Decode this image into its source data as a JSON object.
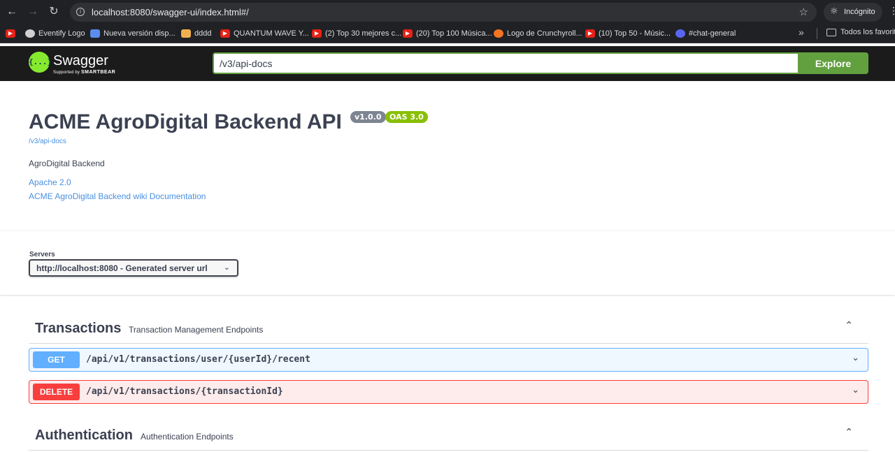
{
  "browser": {
    "url": "localhost:8080/swagger-ui/index.html#/",
    "incognito_label": "Incógnito",
    "bookmarks": [
      {
        "label": "",
        "icon": "youtube-icon"
      },
      {
        "label": "Eventify Logo",
        "icon": "github-icon"
      },
      {
        "label": "Nueva versión disp...",
        "icon": "shield-icon"
      },
      {
        "label": "dddd",
        "icon": "file-icon"
      },
      {
        "label": "QUANTUM WAVE Y...",
        "icon": "youtube-icon"
      },
      {
        "label": "(2) Top 30 mejores c...",
        "icon": "youtube-icon"
      },
      {
        "label": "(20) Top 100 Música...",
        "icon": "youtube-icon"
      },
      {
        "label": "Logo de Crunchyroll...",
        "icon": "crunchyroll-icon"
      },
      {
        "label": "(10) Top 50 - Músic...",
        "icon": "youtube-icon"
      },
      {
        "label": "#chat-general",
        "icon": "discord-icon"
      }
    ],
    "bookmarks_more": "»",
    "all_bookmarks_label": "Todos los favoritos"
  },
  "swagger": {
    "logo_text": "{...}",
    "brand": "Swagger",
    "supported_by": "Supported by",
    "smartbear": "SMARTBEAR",
    "spec_url": "/v3/api-docs",
    "explore_label": "Explore"
  },
  "info": {
    "title": "ACME AgroDigital Backend API",
    "version": "v1.0.0",
    "oas": "OAS 3.0",
    "spec_link": "/v3/api-docs",
    "description": "AgroDigital Backend",
    "license": "Apache 2.0",
    "docs_link": "ACME AgroDigital Backend wiki Documentation"
  },
  "servers": {
    "label": "Servers",
    "selected": "http://localhost:8080 - Generated server url"
  },
  "tags": [
    {
      "name": "Transactions",
      "description": "Transaction Management Endpoints",
      "operations": [
        {
          "method": "GET",
          "path": "/api/v1/transactions/user/{userId}/recent"
        },
        {
          "method": "DELETE",
          "path": "/api/v1/transactions/{transactionId}"
        }
      ]
    },
    {
      "name": "Authentication",
      "description": "Authentication Endpoints",
      "operations": []
    }
  ],
  "colors": {
    "get": "#61affe",
    "delete": "#f93e3e",
    "swagger_green": "#62a03f",
    "topbar": "#1b1b1b"
  }
}
